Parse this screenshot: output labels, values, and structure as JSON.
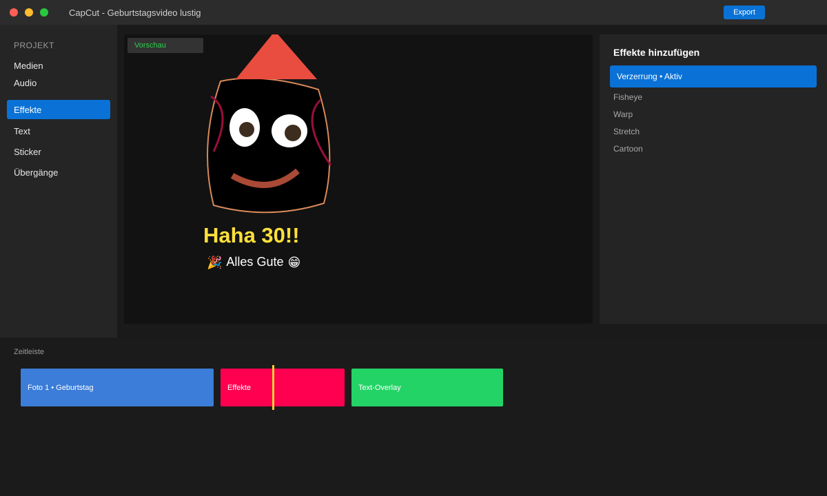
{
  "window": {
    "title": "CapCut - Geburtstagsvideo lustig",
    "export_label": "Export"
  },
  "sidebar": {
    "heading": "PROJEKT",
    "items": [
      {
        "label": "Medien",
        "active": false
      },
      {
        "label": "Audio",
        "active": false
      },
      {
        "label": "Effekte",
        "active": true
      },
      {
        "label": "Text",
        "active": false
      },
      {
        "label": "Sticker",
        "active": false
      },
      {
        "label": "Übergänge",
        "active": false
      }
    ]
  },
  "preview": {
    "tab_label": "Vorschau",
    "overlay_title": "Haha 30!!",
    "overlay_subtitle": "Alles Gute",
    "icons": [
      "party-popper-icon",
      "grinning-face-icon"
    ]
  },
  "effects": {
    "title": "Effekte hinzufügen",
    "items": [
      {
        "label": "Verzerrung • Aktiv",
        "active": true
      },
      {
        "label": "Fisheye",
        "active": false
      },
      {
        "label": "Warp",
        "active": false
      },
      {
        "label": "Stretch",
        "active": false
      },
      {
        "label": "Cartoon",
        "active": false
      }
    ]
  },
  "timeline": {
    "label": "Zeitleiste",
    "clips": [
      {
        "label": "Foto 1 • Geburtstag",
        "color": "#3b7dd8"
      },
      {
        "label": "Effekte",
        "color": "#ff0050"
      },
      {
        "label": "Text-Overlay",
        "color": "#24d366"
      }
    ]
  },
  "colors": {
    "accent": "#0a72d6",
    "title_yellow": "#ffe03a",
    "playhead": "#ffd22e",
    "preview_tab_text": "#2bd24a"
  }
}
